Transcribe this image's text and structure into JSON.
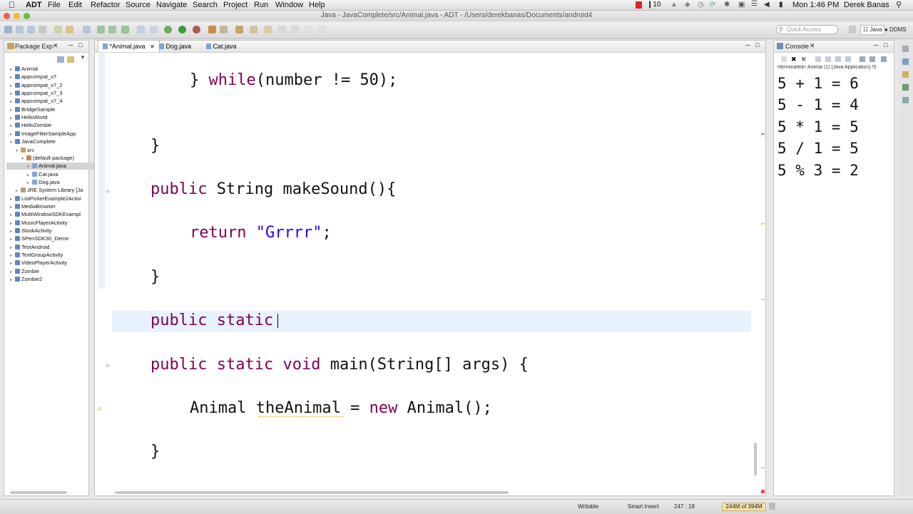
{
  "menubar": {
    "app_name": "ADT",
    "items": [
      "File",
      "Edit",
      "Refactor",
      "Source",
      "Navigate",
      "Search",
      "Project",
      "Run",
      "Window",
      "Help"
    ],
    "status_count": "10",
    "clock": "Mon 1:46 PM",
    "user": "Derek Banas"
  },
  "window": {
    "title": "Java - JavaComplete/src/Animal.java - ADT - /Users/derekbanas/Documents/android4"
  },
  "toolbar": {
    "quick_access_placeholder": "Quick Access",
    "perspectives": [
      "Java",
      "DDMS"
    ]
  },
  "package_explorer": {
    "title": "Package Exp",
    "items": [
      {
        "label": "Animal"
      },
      {
        "label": "appcompat_v7"
      },
      {
        "label": "appcompat_v7_2"
      },
      {
        "label": "appcompat_v7_3"
      },
      {
        "label": "appcompat_v7_4"
      },
      {
        "label": "BridgeSample"
      },
      {
        "label": "HelloWorld"
      },
      {
        "label": "HelloZombie"
      },
      {
        "label": "ImageFilterSampleApp"
      },
      {
        "label": "JavaComplete"
      },
      {
        "label": "src"
      },
      {
        "label": "(default package)"
      },
      {
        "label": "Animal.java"
      },
      {
        "label": "Cat.java"
      },
      {
        "label": "Dog.java"
      },
      {
        "label": "JRE System Library [Ja"
      },
      {
        "label": "ListPickerExample2Activi"
      },
      {
        "label": "MediaBrowser"
      },
      {
        "label": "MultiWindowSDKExampl"
      },
      {
        "label": "MusicPlayerActivity"
      },
      {
        "label": "SlookActivity"
      },
      {
        "label": "SPenSDK30_Demo"
      },
      {
        "label": "TestAndroid"
      },
      {
        "label": "TextGroupActivity"
      },
      {
        "label": "VideoPlayerActivity"
      },
      {
        "label": "Zombie"
      },
      {
        "label": "Zombie2"
      }
    ]
  },
  "editor": {
    "tabs": [
      "*Animal.java",
      "Dog.java",
      "Cat.java"
    ],
    "lines": {
      "l1_a": "} ",
      "l1_kw": "while",
      "l1_b": "(number != 50);",
      "l2": "}",
      "l3_kw": "public",
      "l3_b": " String makeSound(){",
      "l4_kw": "return",
      "l4_sp": " ",
      "l4_str": "\"Grrrr\"",
      "l4_end": ";",
      "l5": "}",
      "l6_kw1": "public",
      "l6_sp": " ",
      "l6_kw2": "static",
      "l7_kw1": "public",
      "l7_kw2": "static",
      "l7_kw3": "void",
      "l7_b": " main(String[] args) {",
      "l8_a": "Animal theAnimal = ",
      "l8_kw": "new",
      "l8_b": " Animal();",
      "l9": "}"
    }
  },
  "console": {
    "title": "Console",
    "status": "<terminated> Animal (1) [Java Application] /S",
    "output": [
      "5 + 1 = 6",
      "5 - 1 = 4",
      "5 * 1 = 5",
      "5 / 1 = 5",
      "5 % 3 = 2"
    ]
  },
  "statusbar": {
    "writable": "Writable",
    "insert_mode": "Smart Insert",
    "position": "247 : 18",
    "memory": "244M of 394M"
  }
}
